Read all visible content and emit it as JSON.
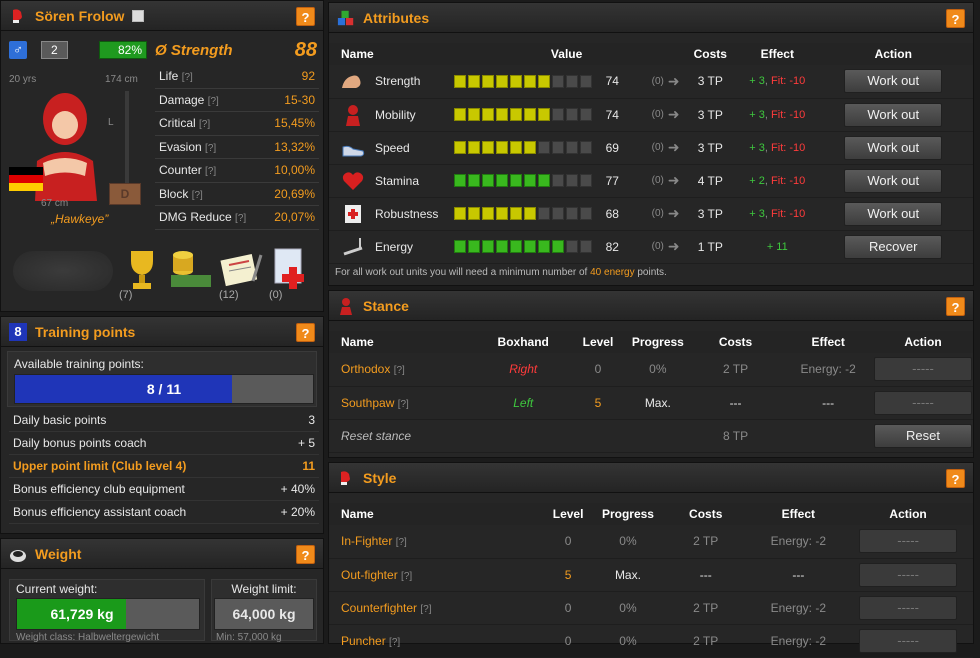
{
  "profile": {
    "name": "Sören Frolow",
    "gender": "♂",
    "level": "2",
    "health_pct": "82%",
    "avg_label": "Ø Strength",
    "avg_value": "88",
    "age": "20 yrs",
    "height": "174 cm",
    "reach": "67 cm",
    "stance_letter": "L",
    "nickname": "„Hawkeye”",
    "stats": [
      {
        "label": "Life",
        "value": "92"
      },
      {
        "label": "Damage",
        "value": "15-30"
      },
      {
        "label": "Critical",
        "value": "15,45%"
      },
      {
        "label": "Evasion",
        "value": "13,32%"
      },
      {
        "label": "Counter",
        "value": "10,00%"
      },
      {
        "label": "Block",
        "value": "20,69%"
      },
      {
        "label": "DMG Reduce",
        "value": "20,07%"
      }
    ],
    "items": [
      {
        "icon": "belt-icon",
        "count": "(7)"
      },
      {
        "icon": "trophy-icon",
        "count": ""
      },
      {
        "icon": "money-icon",
        "count": "(12)"
      },
      {
        "icon": "notes-icon",
        "count": "(0)"
      },
      {
        "icon": "medical-icon",
        "count": ""
      }
    ]
  },
  "training": {
    "badge": "8",
    "title": "Training points",
    "available_label": "Available training points:",
    "available_value": "8 / 11",
    "available_fraction": 0.727,
    "rows": [
      {
        "label": "Daily basic points",
        "value": "3",
        "highlight": false
      },
      {
        "label": "Daily bonus points coach",
        "value": "+ 5",
        "highlight": false
      },
      {
        "label": "Upper point limit (Club level 4)",
        "value": "11",
        "highlight": true
      },
      {
        "label": "Bonus efficiency club equipment",
        "value": "+ 40%",
        "highlight": false
      },
      {
        "label": "Bonus efficiency assistant coach",
        "value": "+ 20%",
        "highlight": false
      }
    ]
  },
  "weight": {
    "title": "Weight",
    "current_label": "Current weight:",
    "current_value": "61,729 kg",
    "current_fraction": 0.6,
    "limit_label": "Weight limit:",
    "limit_value": "64,000 kg",
    "class_text": "Weight class: Halbweltergewicht",
    "min_text": "Min: 57,000 kg"
  },
  "attributes": {
    "title": "Attributes",
    "headers": [
      "Name",
      "Value",
      "Costs",
      "Effect",
      "Action"
    ],
    "rows": [
      {
        "name": "Strength",
        "icon": "bicep-icon",
        "filled": 7,
        "color": "yellow",
        "value": "74",
        "queued": "(0)",
        "cost": "3 TP",
        "effect_plus": "+ 3",
        "effect_minus": "Fit: -10",
        "action": "Work out"
      },
      {
        "name": "Mobility",
        "icon": "boxer-icon",
        "filled": 7,
        "color": "yellow",
        "value": "74",
        "queued": "(0)",
        "cost": "3 TP",
        "effect_plus": "+ 3",
        "effect_minus": "Fit: -10",
        "action": "Work out"
      },
      {
        "name": "Speed",
        "icon": "shoe-icon",
        "filled": 6,
        "color": "yellow",
        "value": "69",
        "queued": "(0)",
        "cost": "3 TP",
        "effect_plus": "+ 3",
        "effect_minus": "Fit: -10",
        "action": "Work out"
      },
      {
        "name": "Stamina",
        "icon": "heart-icon",
        "filled": 7,
        "color": "green",
        "value": "77",
        "queued": "(0)",
        "cost": "4 TP",
        "effect_plus": "+ 2",
        "effect_minus": "Fit: -10",
        "action": "Work out"
      },
      {
        "name": "Robustness",
        "icon": "firstaid-icon",
        "filled": 6,
        "color": "yellow",
        "value": "68",
        "queued": "(0)",
        "cost": "3 TP",
        "effect_plus": "+ 3",
        "effect_minus": "Fit: -10",
        "action": "Work out"
      },
      {
        "name": "Energy",
        "icon": "treadmill-icon",
        "filled": 8,
        "color": "green",
        "value": "82",
        "queued": "(0)",
        "cost": "1 TP",
        "effect_plus": "+ 11",
        "effect_minus": "",
        "action": "Recover"
      }
    ],
    "note_pre": "For all work out units you will need a minimum number of ",
    "note_highlight": "40 energy",
    "note_post": " points."
  },
  "stance": {
    "title": "Stance",
    "headers": [
      "Name",
      "Boxhand",
      "Level",
      "Progress",
      "Costs",
      "Effect",
      "Action"
    ],
    "rows": [
      {
        "name": "Orthodox",
        "hand": "Right",
        "hand_color": "red",
        "level": "0",
        "progress": "0%",
        "cost": "2 TP",
        "effect": "Energy: -2",
        "action": "-----",
        "active": false
      },
      {
        "name": "Southpaw",
        "hand": "Left",
        "hand_color": "green",
        "level": "5",
        "progress": "Max.",
        "cost": "---",
        "effect": "---",
        "action": "-----",
        "active": true
      }
    ],
    "reset_label": "Reset stance",
    "reset_cost": "8 TP",
    "reset_button": "Reset"
  },
  "style": {
    "title": "Style",
    "headers": [
      "Name",
      "Level",
      "Progress",
      "Costs",
      "Effect",
      "Action"
    ],
    "rows": [
      {
        "name": "In-Fighter",
        "level": "0",
        "progress": "0%",
        "cost": "2 TP",
        "effect": "Energy: -2",
        "action": "-----",
        "active": false
      },
      {
        "name": "Out-fighter",
        "level": "5",
        "progress": "Max.",
        "cost": "---",
        "effect": "---",
        "action": "-----",
        "active": true
      },
      {
        "name": "Counterfighter",
        "level": "0",
        "progress": "0%",
        "cost": "2 TP",
        "effect": "Energy: -2",
        "action": "-----",
        "active": false
      },
      {
        "name": "Puncher",
        "level": "0",
        "progress": "0%",
        "cost": "2 TP",
        "effect": "Energy: -2",
        "action": "-----",
        "active": false
      }
    ]
  },
  "colors": {
    "accent": "#f39c1f",
    "bar_yellow": "#c8c800",
    "bar_green": "#39b81e",
    "training_bar": "#1f35b8",
    "weight_bar": "#1a9a1a"
  }
}
